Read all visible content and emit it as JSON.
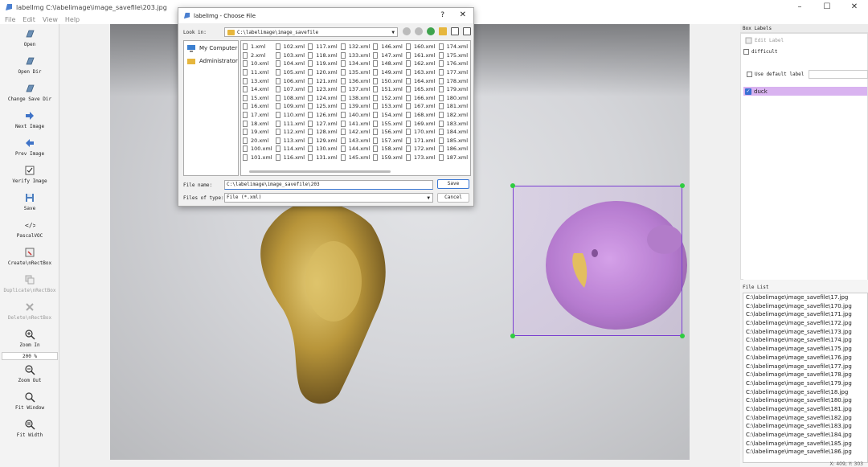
{
  "window": {
    "title": "labelImg C:\\labelimage\\image_savefile\\203.jpg",
    "controls": [
      "–",
      "☐",
      "✕"
    ]
  },
  "menu": [
    "File",
    "Edit",
    "View",
    "Help"
  ],
  "toolbar": {
    "open": "Open",
    "open_dir": "Open Dir",
    "change_save_dir": "Change Save Dir",
    "next_image": "Next Image",
    "prev_image": "Prev Image",
    "verify_image": "Verify Image",
    "save": "Save",
    "format": "PascalVOC",
    "create_rectbox": "Create\\nRectBox",
    "duplicate_rectbox": "Duplicate\\nRectBox",
    "delete_rectbox": "Delete\\nRectBox",
    "zoom_in": "Zoom In",
    "zoom_value": "200 %",
    "zoom_out": "Zoom Out",
    "fit_window": "Fit Window",
    "fit_width": "Fit Width"
  },
  "box_labels": {
    "header": "Box Labels",
    "edit_label": "Edit Label",
    "difficult": "difficult",
    "use_default_label": "Use default label",
    "labels": [
      {
        "name": "duck",
        "checked": true
      }
    ]
  },
  "file_list": {
    "header": "File List",
    "items": [
      "C:\\labelimage\\image_savefile\\17.jpg",
      "C:\\labelimage\\image_savefile\\170.jpg",
      "C:\\labelimage\\image_savefile\\171.jpg",
      "C:\\labelimage\\image_savefile\\172.jpg",
      "C:\\labelimage\\image_savefile\\173.jpg",
      "C:\\labelimage\\image_savefile\\174.jpg",
      "C:\\labelimage\\image_savefile\\175.jpg",
      "C:\\labelimage\\image_savefile\\176.jpg",
      "C:\\labelimage\\image_savefile\\177.jpg",
      "C:\\labelimage\\image_savefile\\178.jpg",
      "C:\\labelimage\\image_savefile\\179.jpg",
      "C:\\labelimage\\image_savefile\\18.jpg",
      "C:\\labelimage\\image_savefile\\180.jpg",
      "C:\\labelimage\\image_savefile\\181.jpg",
      "C:\\labelimage\\image_savefile\\182.jpg",
      "C:\\labelimage\\image_savefile\\183.jpg",
      "C:\\labelimage\\image_savefile\\184.jpg",
      "C:\\labelimage\\image_savefile\\185.jpg",
      "C:\\labelimage\\image_savefile\\186.jpg"
    ]
  },
  "status": "X: 409; Y: 303",
  "dialog": {
    "title": "labelImg - Choose File",
    "help": "?",
    "close": "✕",
    "look_in_label": "Look in:",
    "look_in_path": "C:\\labelimage\\image_savefile",
    "places": [
      "My Computer",
      "Administrator"
    ],
    "files": [
      "1.xml",
      "2.xml",
      "10.xml",
      "11.xml",
      "13.xml",
      "14.xml",
      "15.xml",
      "16.xml",
      "17.xml",
      "18.xml",
      "19.xml",
      "20.xml",
      "100.xml",
      "101.xml",
      "102.xml",
      "103.xml",
      "104.xml",
      "105.xml",
      "106.xml",
      "107.xml",
      "108.xml",
      "109.xml",
      "110.xml",
      "111.xml",
      "112.xml",
      "113.xml",
      "114.xml",
      "116.xml",
      "117.xml",
      "118.xml",
      "119.xml",
      "120.xml",
      "121.xml",
      "123.xml",
      "124.xml",
      "125.xml",
      "126.xml",
      "127.xml",
      "128.xml",
      "129.xml",
      "130.xml",
      "131.xml",
      "132.xml",
      "133.xml",
      "134.xml",
      "135.xml",
      "136.xml",
      "137.xml",
      "138.xml",
      "139.xml",
      "140.xml",
      "141.xml",
      "142.xml",
      "143.xml",
      "144.xml",
      "145.xml",
      "146.xml",
      "147.xml",
      "148.xml",
      "149.xml",
      "150.xml",
      "151.xml",
      "152.xml",
      "153.xml",
      "154.xml",
      "155.xml",
      "156.xml",
      "157.xml",
      "158.xml",
      "159.xml",
      "160.xml",
      "161.xml",
      "162.xml",
      "163.xml",
      "164.xml",
      "165.xml",
      "166.xml",
      "167.xml",
      "168.xml",
      "169.xml",
      "170.xml",
      "171.xml",
      "172.xml",
      "173.xml",
      "174.xml",
      "175.xml",
      "176.xml",
      "177.xml",
      "178.xml",
      "179.xml",
      "180.xml",
      "181.xml",
      "182.xml",
      "183.xml",
      "184.xml",
      "185.xml",
      "186.xml",
      "187.xml"
    ],
    "file_name_label": "File name:",
    "file_name_value": "C:\\labelimage\\image_savefile\\203",
    "file_type_label": "Files of type:",
    "file_type_value": "File (*.xml)",
    "save_button": "Save",
    "cancel_button": "Cancel"
  },
  "colors": {
    "accent": "#3a78d4",
    "bbox": "#7a3fd0",
    "handle": "#2ecc40",
    "label_bg": "#d9b3f0"
  }
}
